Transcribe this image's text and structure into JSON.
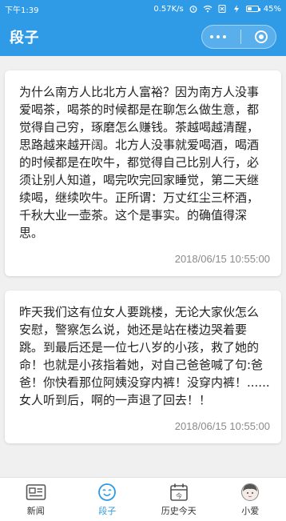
{
  "status_bar": {
    "time": "下午1:39",
    "speed": "0.57K/s",
    "battery": "45%",
    "battery_level": 0.45
  },
  "header": {
    "title": "段子",
    "more_icon": "more-dots-icon",
    "close_icon": "miniapp-close-icon"
  },
  "posts": [
    {
      "text": "为什么南方人比北方人富裕？因为南方人没事爱喝茶，喝茶的时候都是在聊怎么做生意，都觉得自己穷，琢磨怎么赚钱。茶越喝越清醒，思路越来越开阔。北方人没事就爱喝酒，喝酒的时候都是在吹牛，都觉得自己比别人行，必须让别人知道，喝完吹完回家睡觉，第二天继续喝，继续吹牛。正所谓：万丈红尘三杯酒，千秋大业一壶茶。这个是事实。的确值得深思。",
      "time": "2018/06/15 10:55:00"
    },
    {
      "text": "昨天我们这有位女人要跳楼，无论大家伙怎么安慰，警察怎么说，她还是站在楼边哭着要跳。到最后还是一位七八岁的小孩，救了她的命！也就是小孩指着她，对自己爸爸喊了句:爸爸！你快看那位阿姨没穿内裤！没穿内裤！......女人听到后，啊的一声退了回去！！",
      "time": "2018/06/15 10:55:00"
    }
  ],
  "tabs": [
    {
      "label": "新闻",
      "icon": "news-icon"
    },
    {
      "label": "段子",
      "icon": "smile-face-icon",
      "active": true
    },
    {
      "label": "历史今天",
      "icon": "calendar-today-icon"
    },
    {
      "label": "小爱",
      "icon": "avatar-girl-icon"
    }
  ],
  "colors": {
    "primary": "#2f9be7",
    "background": "#f0f0f0",
    "card": "#ffffff",
    "time_text": "#8a8a8a"
  }
}
